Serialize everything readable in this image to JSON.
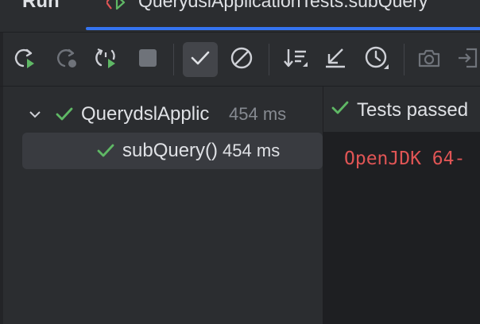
{
  "header": {
    "panel_title": "Run",
    "run_tab": {
      "label": "QuerydslApplicationTests.subQuery"
    }
  },
  "toolbar": {
    "buttons": [
      {
        "id": "rerun",
        "icon": "rerun-icon"
      },
      {
        "id": "rerun-failed",
        "icon": "rerun-failed-icon"
      },
      {
        "id": "toggle-auto-test",
        "icon": "toggle-auto-test-icon"
      },
      {
        "id": "stop",
        "icon": "stop-icon"
      },
      {
        "id": "show-passed",
        "icon": "check-icon",
        "active": true
      },
      {
        "id": "show-ignored",
        "icon": "ignored-icon"
      },
      {
        "id": "sort",
        "icon": "sort-icon"
      },
      {
        "id": "import-tests",
        "icon": "import-tests-icon"
      },
      {
        "id": "test-history",
        "icon": "history-icon"
      },
      {
        "id": "screenshot",
        "icon": "camera-icon"
      },
      {
        "id": "export",
        "icon": "export-icon"
      }
    ]
  },
  "tree": {
    "root": {
      "name": "QuerydslApplic",
      "time": "454 ms"
    },
    "child": {
      "name": "subQuery()",
      "time": "454 ms"
    }
  },
  "console": {
    "status": "Tests passed",
    "first_line": "OpenJDK 64-"
  },
  "colors": {
    "background": "#2b2d30",
    "console_bg": "#1e1f22",
    "accent": "#3574f0",
    "success": "#5fb865",
    "error_text": "#e05555"
  }
}
